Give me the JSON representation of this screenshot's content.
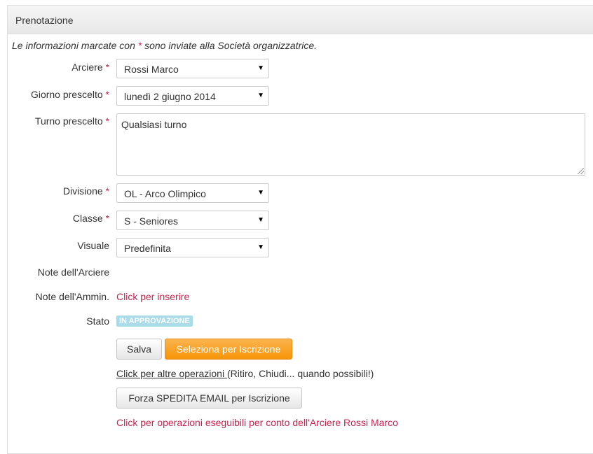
{
  "panel": {
    "title": "Prenotazione"
  },
  "info": {
    "before": "Le informazioni marcate con ",
    "star": "*",
    "after": " sono inviate alla Società organizzatrice."
  },
  "fields": {
    "arciere": {
      "label": "Arciere",
      "value": "Rossi Marco"
    },
    "giorno": {
      "label": "Giorno prescelto",
      "value": "lunedì 2 giugno 2014"
    },
    "turno": {
      "label": "Turno prescelto",
      "value": "Qualsiasi turno"
    },
    "divisione": {
      "label": "Divisione",
      "value": "OL - Arco Olimpico"
    },
    "classe": {
      "label": "Classe",
      "value": "S - Seniores"
    },
    "visuale": {
      "label": "Visuale",
      "value": "Predefinita"
    },
    "note_arciere": {
      "label": "Note dell'Arciere"
    },
    "note_ammin": {
      "label": "Note dell'Ammin.",
      "link": "Click per inserire"
    },
    "stato": {
      "label": "Stato",
      "badge": "IN APPROVAZIONE"
    }
  },
  "required_star": "*",
  "buttons": {
    "salva": "Salva",
    "seleziona": "Seleziona per Iscrizione",
    "forza_email": "Forza SPEDITA EMAIL per Iscrizione"
  },
  "ops": {
    "link": "Click per altre operazioni ",
    "rest": "(Ritiro, Chiudi... quando possibili!)"
  },
  "bottom_link": "Click per operazioni eseguibili per conto dell'Arciere Rossi Marco",
  "colors": {
    "required": "#c7254e",
    "badge": "#a9dbe8",
    "orange": "#f89406"
  }
}
